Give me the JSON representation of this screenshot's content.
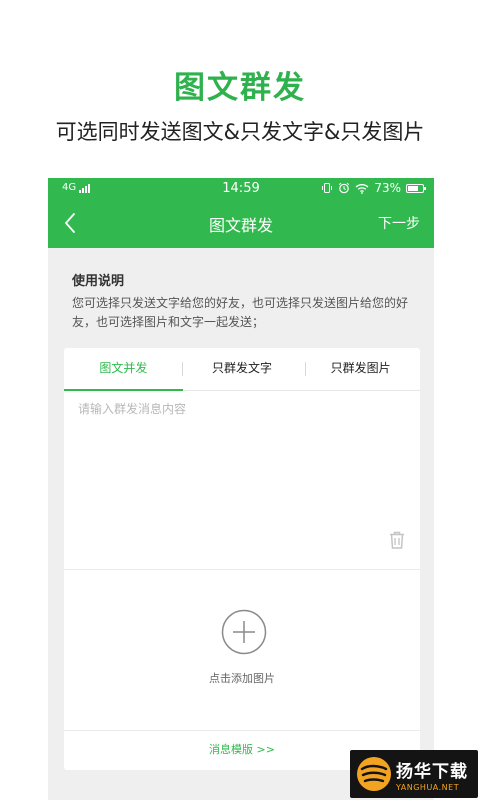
{
  "promo": {
    "title": "图文群发",
    "subtitle": "可选同时发送图文&只发文字&只发图片"
  },
  "status_bar": {
    "network": "4G",
    "time": "14:59",
    "battery": "73%",
    "icons": [
      "vibrate-icon",
      "alarm-icon",
      "wifi-icon",
      "battery-icon"
    ]
  },
  "navbar": {
    "back_icon": "back-arrow-icon",
    "title": "图文群发",
    "next_label": "下一步"
  },
  "help": {
    "title": "使用说明",
    "text": "您可选择只发送文字给您的好友，也可选择只发送图片给您的好友，也可选择图片和文字一起发送；"
  },
  "tabs": [
    {
      "label": "图文并发",
      "active": true
    },
    {
      "label": "只群发文字",
      "active": false
    },
    {
      "label": "只群发图片",
      "active": false
    }
  ],
  "message": {
    "placeholder": "请输入群发消息内容",
    "value": ""
  },
  "image_upload": {
    "label": "点击添加图片"
  },
  "template": {
    "label": "消息模版 >>"
  },
  "watermark": {
    "name_cn": "扬华下载",
    "name_en": "YANGHUA.NET"
  },
  "colors": {
    "accent": "#31b94f",
    "promo_title": "#2fb24e",
    "background": "#efefef",
    "watermark_bg": "#141414",
    "watermark_accent": "#f3a322"
  }
}
